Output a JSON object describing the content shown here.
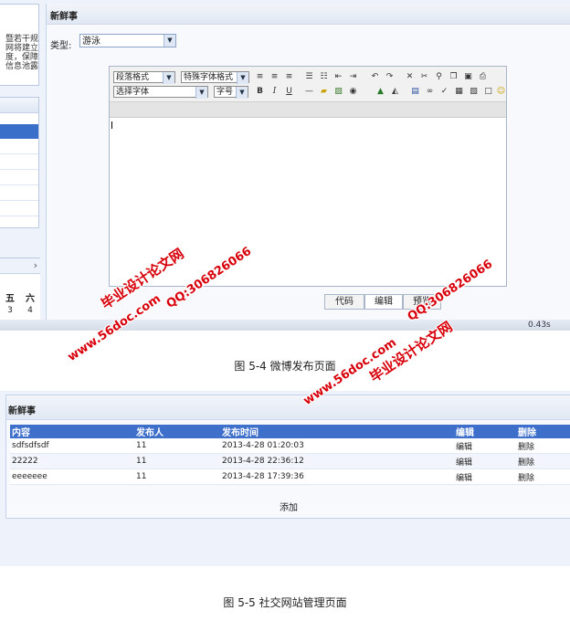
{
  "left_panel": {
    "notice_lines": [
      "暨若干规",
      "网将建立",
      "度，保障",
      "信息池露"
    ],
    "calendar": {
      "nav_icon": "chevron-right-icon",
      "days": [
        "五",
        "六"
      ],
      "nums": [
        "3",
        "4"
      ]
    }
  },
  "post_panel": {
    "title": "新鲜事",
    "type_label": "类型:",
    "type_value": "游泳",
    "toolbar": {
      "paragraph_select": "段落格式",
      "special_font_select": "特殊字体格式",
      "font_select": "选择字体",
      "size_select": "字号",
      "bold": "B",
      "italic": "I",
      "underline": "U"
    },
    "tabs": {
      "code": "代码",
      "edit": "编辑",
      "preview": "预览"
    },
    "timer": "0.43s"
  },
  "captions": {
    "fig1": "图 5-4 微博发布页面",
    "fig2": "图 5-5 社交网站管理页面"
  },
  "manage_panel": {
    "title": "新鲜事",
    "columns": [
      "内容",
      "发布人",
      "发布时间",
      "编辑",
      "删除"
    ],
    "rows": [
      {
        "content": "sdfsdfsdf",
        "publisher": "11",
        "time": "2013-4-28 01:20:03",
        "edit": "编辑",
        "delete": "删除"
      },
      {
        "content": "22222",
        "publisher": "11",
        "time": "2013-4-28 22:36:12",
        "edit": "编辑",
        "delete": "删除"
      },
      {
        "content": "eeeeeee",
        "publisher": "11",
        "time": "2013-4-28 17:39:36",
        "edit": "编辑",
        "delete": "删除"
      }
    ],
    "add_label": "添加"
  },
  "watermarks": {
    "site_name": "毕业设计论文网",
    "site_url": "www.56doc.com",
    "qq": "QQ:306826066"
  }
}
